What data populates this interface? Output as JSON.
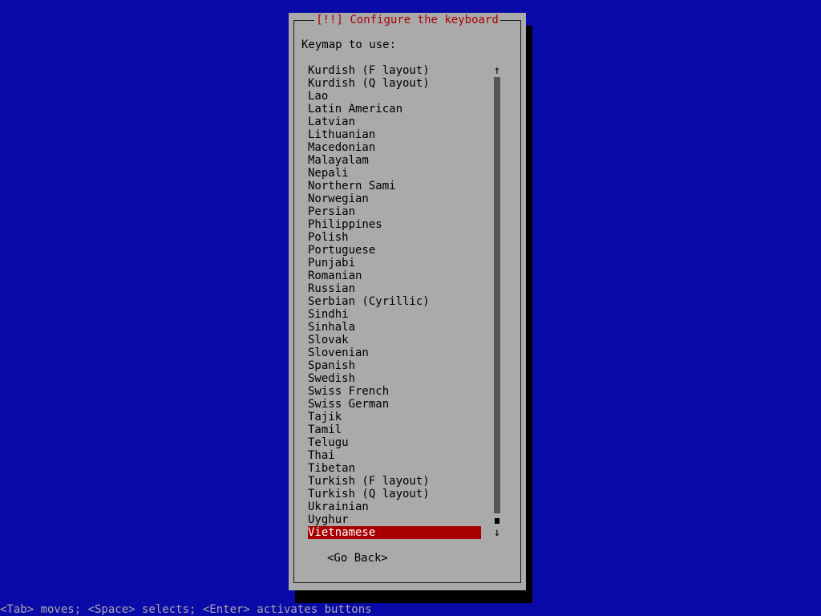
{
  "dialog": {
    "title": "[!!] Configure the keyboard",
    "prompt": "Keymap to use:",
    "items": [
      "Kurdish (F layout)",
      "Kurdish (Q layout)",
      "Lao",
      "Latin American",
      "Latvian",
      "Lithuanian",
      "Macedonian",
      "Malayalam",
      "Nepali",
      "Northern Sami",
      "Norwegian",
      "Persian",
      "Philippines",
      "Polish",
      "Portuguese",
      "Punjabi",
      "Romanian",
      "Russian",
      "Serbian (Cyrillic)",
      "Sindhi",
      "Sinhala",
      "Slovak",
      "Slovenian",
      "Spanish",
      "Swedish",
      "Swiss French",
      "Swiss German",
      "Tajik",
      "Tamil",
      "Telugu",
      "Thai",
      "Tibetan",
      "Turkish (F layout)",
      "Turkish (Q layout)",
      "Ukrainian",
      "Uyghur",
      "Vietnamese"
    ],
    "selected_item": "Vietnamese",
    "go_back_label": "<Go Back>",
    "scroll_up_icon": "↑",
    "scroll_down_icon": "↓"
  },
  "status_bar": {
    "text": "<Tab> moves; <Space> selects; <Enter> activates buttons"
  },
  "colors": {
    "background": "#0a0aa8",
    "dialog": "#aaaaaa",
    "title": "#a80000",
    "selection": "#a80000"
  }
}
